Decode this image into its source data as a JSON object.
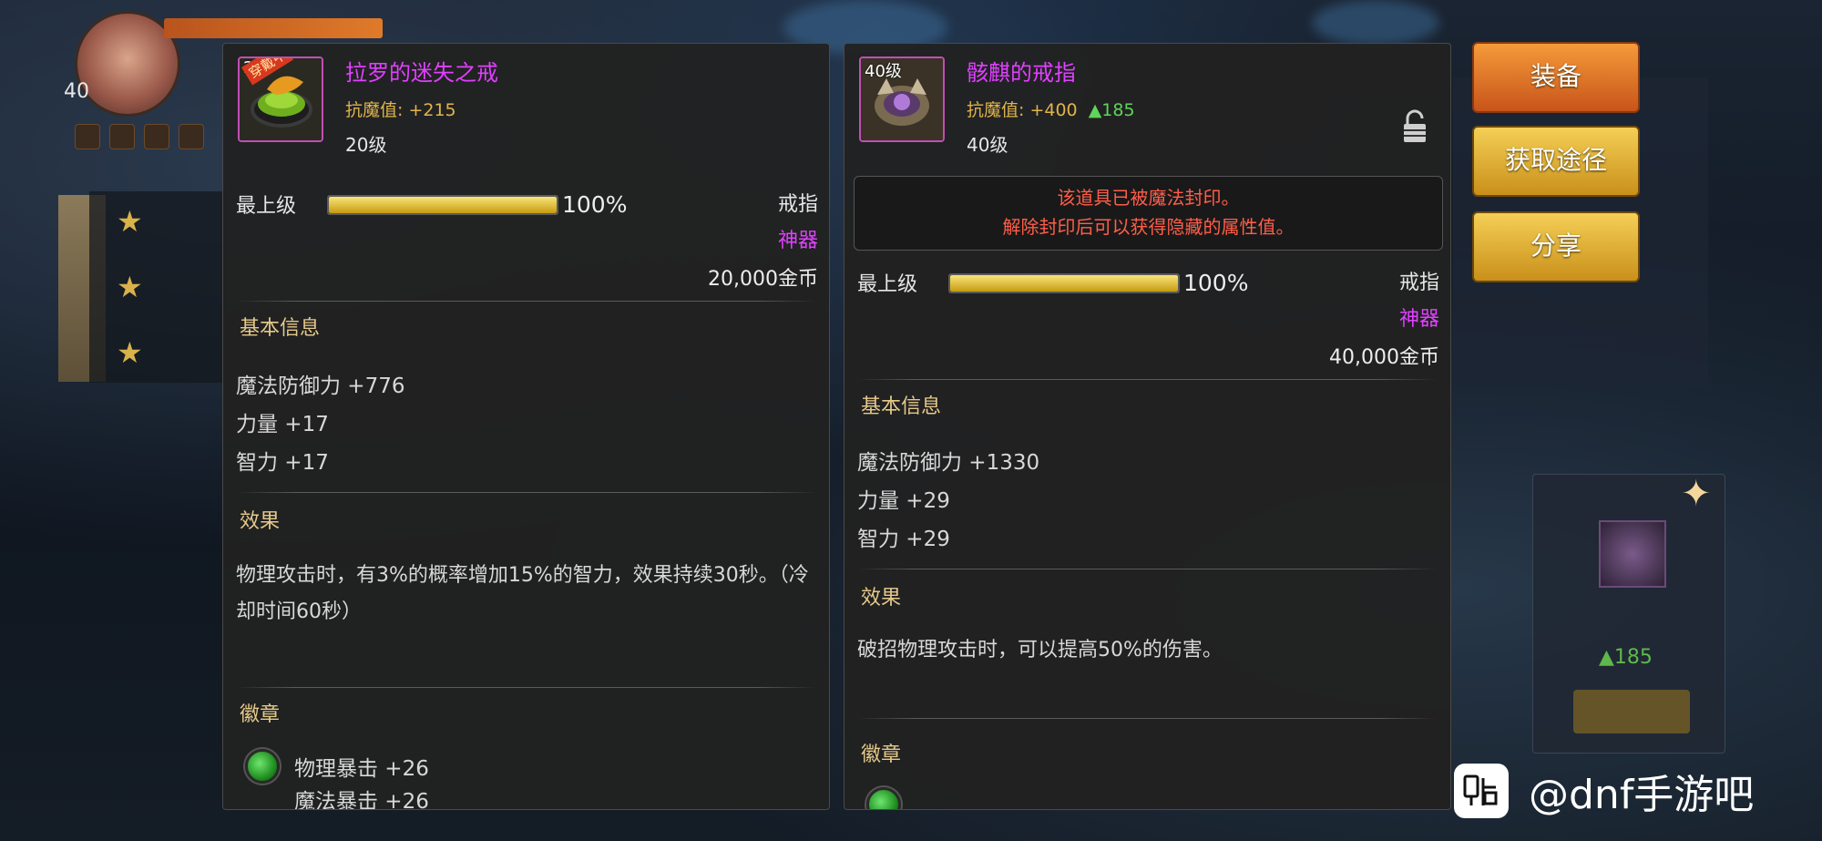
{
  "hud": {
    "player_level": "40"
  },
  "left_item": {
    "icon_level": "2",
    "wearing_badge": "穿戴中",
    "name": "拉罗的迷失之戒",
    "stat_label": "抗魔值:",
    "stat_value": "+215",
    "level": "20级",
    "grade_label": "最上级",
    "grade_percent_text": "100%",
    "grade_fraction": 1.0,
    "type": "戒指",
    "rarity": "神器",
    "price": "20,000金币",
    "basic_info_title": "基本信息",
    "attributes": [
      "魔法防御力 +776",
      "力量 +17",
      "智力 +17"
    ],
    "effect_title": "效果",
    "effect_text": "物理攻击时，有3%的概率增加15%的智力，效果持续30秒。（冷却时间60秒）",
    "emblem_title": "徽章",
    "emblems": [
      "物理暴击 +26",
      "魔法暴击 +26"
    ]
  },
  "right_item": {
    "icon_level": "40级",
    "name": "骸麒的戒指",
    "stat_label": "抗魔值:",
    "stat_value": "+400",
    "stat_up": "▲185",
    "level": "40级",
    "seal_line1": "该道具已被魔法封印。",
    "seal_line2": "解除封印后可以获得隐藏的属性值。",
    "grade_label": "最上级",
    "grade_percent_text": "100%",
    "grade_fraction": 1.0,
    "type": "戒指",
    "rarity": "神器",
    "price": "40,000金币",
    "basic_info_title": "基本信息",
    "attributes": [
      "魔法防御力 +1330",
      "力量 +29",
      "智力 +29"
    ],
    "effect_title": "效果",
    "effect_text": "破招物理攻击时，可以提高50%的伤害。",
    "emblem_title": "徽章"
  },
  "actions": {
    "equip": "装备",
    "obtain": "获取途径",
    "share": "分享"
  },
  "side_card": {
    "up_value": "▲185"
  },
  "watermark": {
    "text": "@dnf手游吧"
  },
  "colors": {
    "rarity": "#e040ff",
    "stat": "#e0b54a",
    "seal_warning": "#ff5e4a",
    "stat_up": "#5fd55a"
  }
}
